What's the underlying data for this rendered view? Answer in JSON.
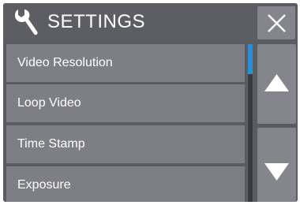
{
  "header": {
    "title": "SETTINGS",
    "icon": "wrench-icon",
    "close_icon": "close-icon"
  },
  "menu": {
    "items": [
      {
        "label": "Video Resolution"
      },
      {
        "label": "Loop Video"
      },
      {
        "label": "Time Stamp"
      },
      {
        "label": "Exposure"
      }
    ]
  },
  "scroll": {
    "up_icon": "triangle-up-icon",
    "down_icon": "triangle-down-icon",
    "position_fraction": 0.0
  },
  "colors": {
    "panel": "#5b5c63",
    "item_background": "#7e7f86",
    "button_background": "#85868d",
    "scrollbar_thumb": "#2a8fd6",
    "text": "#ffffff"
  }
}
